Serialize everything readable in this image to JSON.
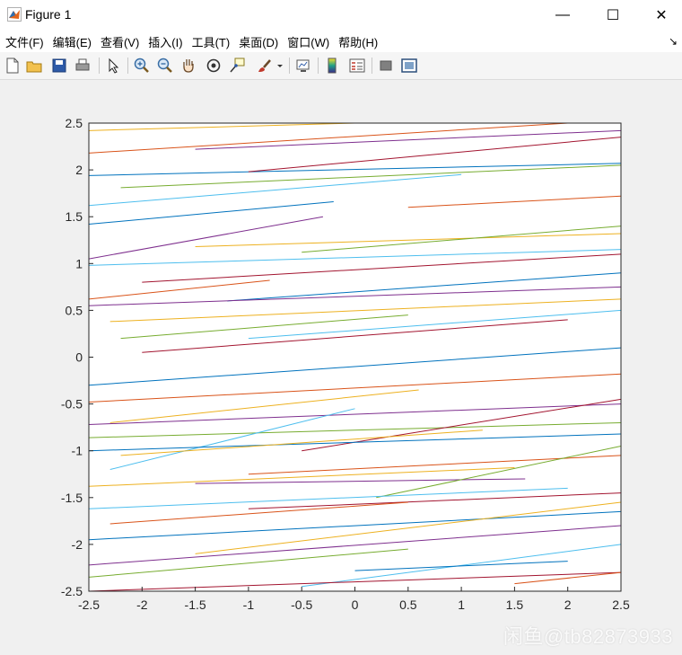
{
  "window": {
    "title": "Figure 1",
    "minimize_glyph": "—",
    "maximize_glyph": "☐",
    "close_glyph": "✕"
  },
  "menubar": {
    "items": [
      "文件(F)",
      "编辑(E)",
      "查看(V)",
      "插入(I)",
      "工具(T)",
      "桌面(D)",
      "窗口(W)",
      "帮助(H)"
    ],
    "overflow_glyph": "↘"
  },
  "toolbar": {
    "icons": [
      "new-figure-icon",
      "open-file-icon",
      "save-icon",
      "print-icon",
      "edit-plot-arrow-icon",
      "zoom-in-icon",
      "zoom-out-icon",
      "pan-hand-icon",
      "rotate-3d-icon",
      "data-cursor-icon",
      "brush-icon",
      "brush-dropdown-icon",
      "link-plot-icon",
      "colorbar-icon",
      "legend-icon",
      "hide-plot-tools-icon",
      "show-plot-tools-icon"
    ]
  },
  "watermark": "闲鱼@tb82873933",
  "colors": {
    "line_colors": [
      "#0072BD",
      "#D95319",
      "#EDB120",
      "#7E2F8E",
      "#77AC30",
      "#4DBEEE",
      "#A2142F"
    ]
  },
  "chart_data": {
    "type": "line",
    "xlim": [
      -2.5,
      2.5
    ],
    "ylim": [
      -2.5,
      2.5
    ],
    "x_ticks": [
      "-2.5",
      "-2",
      "-1.5",
      "-1",
      "-0.5",
      "0",
      "0.5",
      "1",
      "1.5",
      "2",
      "2.5"
    ],
    "y_ticks": [
      "2.5",
      "2",
      "1.5",
      "1",
      "0.5",
      "0",
      "-0.5",
      "-1",
      "-1.5",
      "-2",
      "-2.5"
    ],
    "grid": false,
    "series": [
      {
        "x": [
          -2.5,
          2.5
        ],
        "y": [
          1.94,
          2.07
        ]
      },
      {
        "x": [
          -2.5,
          2.0
        ],
        "y": [
          2.18,
          2.5
        ]
      },
      {
        "x": [
          -2.5,
          0.0
        ],
        "y": [
          2.42,
          2.5
        ]
      },
      {
        "x": [
          -1.5,
          2.5
        ],
        "y": [
          2.22,
          2.42
        ]
      },
      {
        "x": [
          -2.2,
          2.5
        ],
        "y": [
          1.81,
          2.05
        ]
      },
      {
        "x": [
          -2.5,
          1.0
        ],
        "y": [
          1.62,
          1.95
        ]
      },
      {
        "x": [
          -1.0,
          2.5
        ],
        "y": [
          1.98,
          2.35
        ]
      },
      {
        "x": [
          -2.5,
          -0.2
        ],
        "y": [
          1.42,
          1.66
        ]
      },
      {
        "x": [
          0.5,
          2.5
        ],
        "y": [
          1.6,
          1.72
        ]
      },
      {
        "x": [
          -1.5,
          2.5
        ],
        "y": [
          1.18,
          1.32
        ]
      },
      {
        "x": [
          -2.5,
          -0.3
        ],
        "y": [
          1.05,
          1.5
        ]
      },
      {
        "x": [
          -0.5,
          2.5
        ],
        "y": [
          1.12,
          1.4
        ]
      },
      {
        "x": [
          -2.5,
          2.5
        ],
        "y": [
          0.98,
          1.15
        ]
      },
      {
        "x": [
          -2.0,
          2.5
        ],
        "y": [
          0.8,
          1.1
        ]
      },
      {
        "x": [
          -1.2,
          2.5
        ],
        "y": [
          0.6,
          0.9
        ]
      },
      {
        "x": [
          -2.5,
          -0.8
        ],
        "y": [
          0.62,
          0.82
        ]
      },
      {
        "x": [
          -2.3,
          2.5
        ],
        "y": [
          0.38,
          0.62
        ]
      },
      {
        "x": [
          -2.5,
          2.5
        ],
        "y": [
          0.55,
          0.75
        ]
      },
      {
        "x": [
          -2.2,
          0.5
        ],
        "y": [
          0.2,
          0.45
        ]
      },
      {
        "x": [
          -1.0,
          2.5
        ],
        "y": [
          0.2,
          0.5
        ]
      },
      {
        "x": [
          -2.0,
          2.0
        ],
        "y": [
          0.05,
          0.4
        ]
      },
      {
        "x": [
          -2.5,
          2.5
        ],
        "y": [
          -0.3,
          0.1
        ]
      },
      {
        "x": [
          -2.5,
          2.5
        ],
        "y": [
          -0.48,
          -0.18
        ]
      },
      {
        "x": [
          -2.3,
          0.6
        ],
        "y": [
          -0.7,
          -0.35
        ]
      },
      {
        "x": [
          -2.5,
          2.5
        ],
        "y": [
          -0.72,
          -0.5
        ]
      },
      {
        "x": [
          -2.5,
          2.5
        ],
        "y": [
          -0.86,
          -0.7
        ]
      },
      {
        "x": [
          -2.3,
          0.0
        ],
        "y": [
          -1.2,
          -0.55
        ]
      },
      {
        "x": [
          -0.5,
          2.5
        ],
        "y": [
          -1.0,
          -0.45
        ]
      },
      {
        "x": [
          -2.5,
          2.5
        ],
        "y": [
          -1.0,
          -0.82
        ]
      },
      {
        "x": [
          -1.0,
          2.5
        ],
        "y": [
          -1.25,
          -1.05
        ]
      },
      {
        "x": [
          -2.5,
          1.5
        ],
        "y": [
          -1.38,
          -1.18
        ]
      },
      {
        "x": [
          -1.5,
          1.6
        ],
        "y": [
          -1.35,
          -1.3
        ]
      },
      {
        "x": [
          0.2,
          2.5
        ],
        "y": [
          -1.5,
          -0.95
        ]
      },
      {
        "x": [
          -2.5,
          2.0
        ],
        "y": [
          -1.62,
          -1.4
        ]
      },
      {
        "x": [
          -1.0,
          2.5
        ],
        "y": [
          -1.62,
          -1.45
        ]
      },
      {
        "x": [
          -2.5,
          2.5
        ],
        "y": [
          -1.95,
          -1.65
        ]
      },
      {
        "x": [
          -2.3,
          0.5
        ],
        "y": [
          -1.78,
          -1.55
        ]
      },
      {
        "x": [
          -1.5,
          2.5
        ],
        "y": [
          -2.1,
          -1.55
        ]
      },
      {
        "x": [
          -2.5,
          2.5
        ],
        "y": [
          -2.22,
          -1.8
        ]
      },
      {
        "x": [
          -2.5,
          0.5
        ],
        "y": [
          -2.35,
          -2.05
        ]
      },
      {
        "x": [
          -0.5,
          2.5
        ],
        "y": [
          -2.45,
          -2.0
        ]
      },
      {
        "x": [
          -2.5,
          2.5
        ],
        "y": [
          -2.5,
          -2.3
        ]
      },
      {
        "x": [
          0.0,
          2.0
        ],
        "y": [
          -2.28,
          -2.18
        ]
      },
      {
        "x": [
          1.5,
          2.5
        ],
        "y": [
          -2.42,
          -2.3
        ]
      },
      {
        "x": [
          -2.2,
          1.2
        ],
        "y": [
          -1.05,
          -0.78
        ]
      }
    ]
  }
}
